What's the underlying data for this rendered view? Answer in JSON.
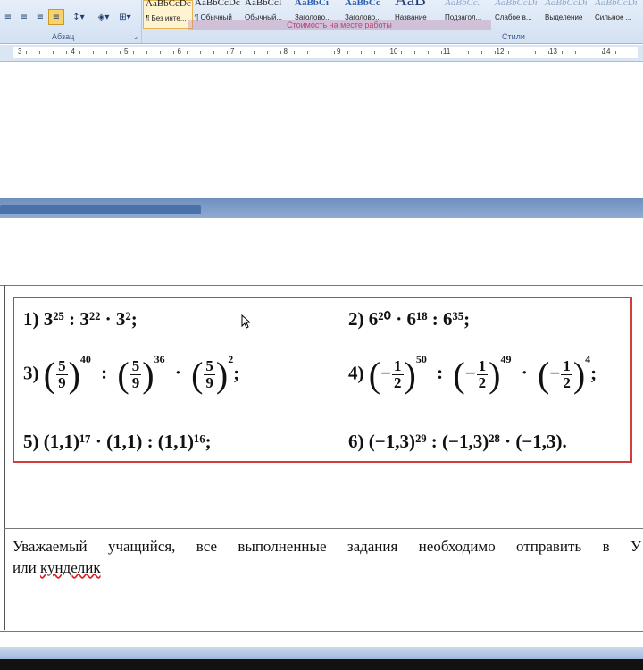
{
  "ribbon": {
    "paragraph_group_label": "Абзац",
    "styles_group_label": "Стили",
    "overlay_text": "Стоимость на месте работы",
    "styles": [
      {
        "sample": "AaBbCcDc",
        "name": "¶ Без инте...",
        "selected": true
      },
      {
        "sample": "AaBbCcDc",
        "name": "¶ Обычный",
        "selected": false
      },
      {
        "sample": "AaBbCcI",
        "name": "Обычный...",
        "selected": false
      },
      {
        "sample": "AaBbCi",
        "name": "Заголово...",
        "selected": false
      },
      {
        "sample": "AaBbCc",
        "name": "Заголово...",
        "selected": false
      },
      {
        "sample": "AaB",
        "name": "Название",
        "selected": false
      },
      {
        "sample": "AaBbCc.",
        "name": "Подзагол...",
        "selected": false
      },
      {
        "sample": "AaBbCcDi",
        "name": "Слабое в...",
        "selected": false
      },
      {
        "sample": "AaBbCcDi",
        "name": "Выделение",
        "selected": false
      },
      {
        "sample": "AaBbCcDi",
        "name": "Сильное ...",
        "selected": false
      }
    ]
  },
  "ruler": {
    "numbers": [
      "3",
      "4",
      "5",
      "6",
      "7",
      "8",
      "9",
      "10",
      "11",
      "12",
      "13",
      "14"
    ]
  },
  "tasks": {
    "p1": {
      "label": "1)",
      "expr": "3²⁵ : 3²² · 3²;"
    },
    "p2": {
      "label": "2)",
      "expr": "6²⁰ · 6¹⁸ : 6³⁵;"
    },
    "p3": {
      "label": "3)",
      "base_num": "5",
      "base_den": "9",
      "exp1": "40",
      "exp2": "36",
      "exp3": "2"
    },
    "p4": {
      "label": "4)",
      "sign": "−",
      "base_num": "1",
      "base_den": "2",
      "exp1": "50",
      "exp2": "49",
      "exp3": "4"
    },
    "p5": {
      "label": "5)",
      "expr": "(1,1)¹⁷ · (1,1) : (1,1)¹⁶;"
    },
    "p6": {
      "label": "6)",
      "expr": "(−1,3)²⁹ : (−1,3)²⁸ · (−1,3)."
    }
  },
  "message": {
    "line1": "Уважаемый учащийся, все выполненные задания необходимо отправить в У",
    "line2_prefix": "или ",
    "line2_word": "кунделик"
  }
}
